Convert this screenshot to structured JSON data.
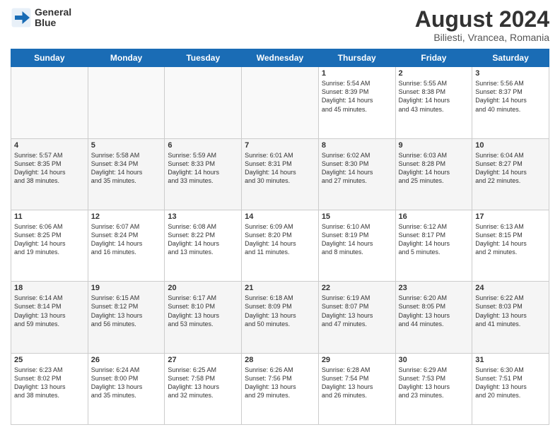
{
  "header": {
    "logo": {
      "line1": "General",
      "line2": "Blue"
    },
    "title": "August 2024",
    "location": "Biliesti, Vrancea, Romania"
  },
  "days_of_week": [
    "Sunday",
    "Monday",
    "Tuesday",
    "Wednesday",
    "Thursday",
    "Friday",
    "Saturday"
  ],
  "weeks": [
    [
      {
        "day": "",
        "info": ""
      },
      {
        "day": "",
        "info": ""
      },
      {
        "day": "",
        "info": ""
      },
      {
        "day": "",
        "info": ""
      },
      {
        "day": "1",
        "info": "Sunrise: 5:54 AM\nSunset: 8:39 PM\nDaylight: 14 hours\nand 45 minutes."
      },
      {
        "day": "2",
        "info": "Sunrise: 5:55 AM\nSunset: 8:38 PM\nDaylight: 14 hours\nand 43 minutes."
      },
      {
        "day": "3",
        "info": "Sunrise: 5:56 AM\nSunset: 8:37 PM\nDaylight: 14 hours\nand 40 minutes."
      }
    ],
    [
      {
        "day": "4",
        "info": "Sunrise: 5:57 AM\nSunset: 8:35 PM\nDaylight: 14 hours\nand 38 minutes."
      },
      {
        "day": "5",
        "info": "Sunrise: 5:58 AM\nSunset: 8:34 PM\nDaylight: 14 hours\nand 35 minutes."
      },
      {
        "day": "6",
        "info": "Sunrise: 5:59 AM\nSunset: 8:33 PM\nDaylight: 14 hours\nand 33 minutes."
      },
      {
        "day": "7",
        "info": "Sunrise: 6:01 AM\nSunset: 8:31 PM\nDaylight: 14 hours\nand 30 minutes."
      },
      {
        "day": "8",
        "info": "Sunrise: 6:02 AM\nSunset: 8:30 PM\nDaylight: 14 hours\nand 27 minutes."
      },
      {
        "day": "9",
        "info": "Sunrise: 6:03 AM\nSunset: 8:28 PM\nDaylight: 14 hours\nand 25 minutes."
      },
      {
        "day": "10",
        "info": "Sunrise: 6:04 AM\nSunset: 8:27 PM\nDaylight: 14 hours\nand 22 minutes."
      }
    ],
    [
      {
        "day": "11",
        "info": "Sunrise: 6:06 AM\nSunset: 8:25 PM\nDaylight: 14 hours\nand 19 minutes."
      },
      {
        "day": "12",
        "info": "Sunrise: 6:07 AM\nSunset: 8:24 PM\nDaylight: 14 hours\nand 16 minutes."
      },
      {
        "day": "13",
        "info": "Sunrise: 6:08 AM\nSunset: 8:22 PM\nDaylight: 14 hours\nand 13 minutes."
      },
      {
        "day": "14",
        "info": "Sunrise: 6:09 AM\nSunset: 8:20 PM\nDaylight: 14 hours\nand 11 minutes."
      },
      {
        "day": "15",
        "info": "Sunrise: 6:10 AM\nSunset: 8:19 PM\nDaylight: 14 hours\nand 8 minutes."
      },
      {
        "day": "16",
        "info": "Sunrise: 6:12 AM\nSunset: 8:17 PM\nDaylight: 14 hours\nand 5 minutes."
      },
      {
        "day": "17",
        "info": "Sunrise: 6:13 AM\nSunset: 8:15 PM\nDaylight: 14 hours\nand 2 minutes."
      }
    ],
    [
      {
        "day": "18",
        "info": "Sunrise: 6:14 AM\nSunset: 8:14 PM\nDaylight: 13 hours\nand 59 minutes."
      },
      {
        "day": "19",
        "info": "Sunrise: 6:15 AM\nSunset: 8:12 PM\nDaylight: 13 hours\nand 56 minutes."
      },
      {
        "day": "20",
        "info": "Sunrise: 6:17 AM\nSunset: 8:10 PM\nDaylight: 13 hours\nand 53 minutes."
      },
      {
        "day": "21",
        "info": "Sunrise: 6:18 AM\nSunset: 8:09 PM\nDaylight: 13 hours\nand 50 minutes."
      },
      {
        "day": "22",
        "info": "Sunrise: 6:19 AM\nSunset: 8:07 PM\nDaylight: 13 hours\nand 47 minutes."
      },
      {
        "day": "23",
        "info": "Sunrise: 6:20 AM\nSunset: 8:05 PM\nDaylight: 13 hours\nand 44 minutes."
      },
      {
        "day": "24",
        "info": "Sunrise: 6:22 AM\nSunset: 8:03 PM\nDaylight: 13 hours\nand 41 minutes."
      }
    ],
    [
      {
        "day": "25",
        "info": "Sunrise: 6:23 AM\nSunset: 8:02 PM\nDaylight: 13 hours\nand 38 minutes."
      },
      {
        "day": "26",
        "info": "Sunrise: 6:24 AM\nSunset: 8:00 PM\nDaylight: 13 hours\nand 35 minutes."
      },
      {
        "day": "27",
        "info": "Sunrise: 6:25 AM\nSunset: 7:58 PM\nDaylight: 13 hours\nand 32 minutes."
      },
      {
        "day": "28",
        "info": "Sunrise: 6:26 AM\nSunset: 7:56 PM\nDaylight: 13 hours\nand 29 minutes."
      },
      {
        "day": "29",
        "info": "Sunrise: 6:28 AM\nSunset: 7:54 PM\nDaylight: 13 hours\nand 26 minutes."
      },
      {
        "day": "30",
        "info": "Sunrise: 6:29 AM\nSunset: 7:53 PM\nDaylight: 13 hours\nand 23 minutes."
      },
      {
        "day": "31",
        "info": "Sunrise: 6:30 AM\nSunset: 7:51 PM\nDaylight: 13 hours\nand 20 minutes."
      }
    ]
  ]
}
